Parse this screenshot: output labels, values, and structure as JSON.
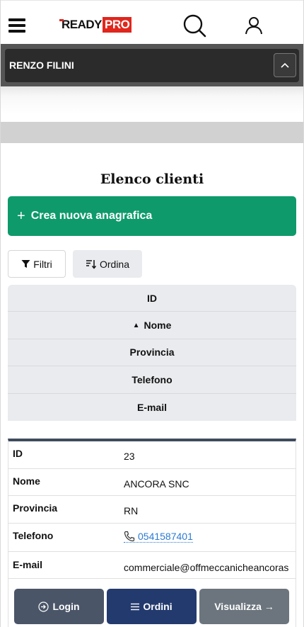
{
  "header": {
    "logo_ready": "READY",
    "logo_pro": "PRO"
  },
  "user_bar": {
    "name": "RENZO FILINI"
  },
  "page": {
    "title": "Elenco clienti"
  },
  "actions_top": {
    "create_plus": "+",
    "create_label": "Crea nuova anagrafica",
    "filter_label": "Filtri",
    "sort_label": "Ordina"
  },
  "sort_columns": [
    {
      "label": "ID"
    },
    {
      "label": "Nome",
      "active": true,
      "direction": "asc"
    },
    {
      "label": "Provincia"
    },
    {
      "label": "Telefono"
    },
    {
      "label": "E-mail"
    }
  ],
  "client_card": {
    "fields": {
      "id": {
        "label": "ID",
        "value": "23"
      },
      "nome": {
        "label": "Nome",
        "value": "ANCORA SNC"
      },
      "provincia": {
        "label": "Provincia",
        "value": "RN"
      },
      "telefono": {
        "label": "Telefono",
        "value": "0541587401"
      },
      "email": {
        "label": "E-mail",
        "value": "commerciale@offmeccanicheancoras"
      }
    },
    "buttons": {
      "login": "Login",
      "ordini": "Ordini",
      "visualizza": "Visualizza →"
    }
  },
  "colors": {
    "brand_red": "#e0261d",
    "create_green": "#0e9a6b",
    "login_btn": "#4a5568",
    "orders_btn": "#233a6e",
    "view_btn": "#6c757d",
    "link_blue": "#2a7bd4"
  },
  "icons": {
    "menu": "hamburger-icon",
    "search": "search-icon",
    "user": "user-icon",
    "collapse": "chevron-up-icon",
    "filter": "funnel-icon",
    "sort": "sort-icon",
    "phone": "phone-icon",
    "login": "login-icon",
    "orders": "list-icon"
  }
}
